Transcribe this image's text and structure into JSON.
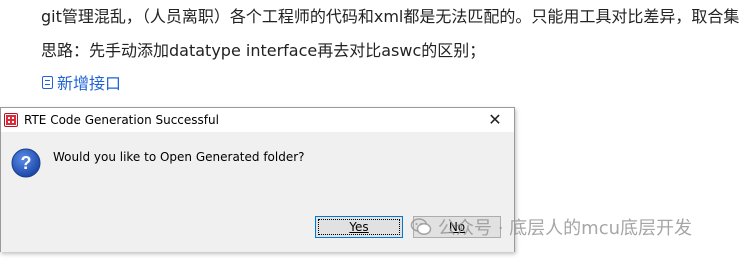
{
  "article": {
    "line1": "git管理混乱，（人员离职）各个工程师的代码和xml都是无法匹配的。只能用工具对比差异，取合集",
    "line2": "思路：先手动添加datatype interface再去对比aswc的区别；",
    "link_label": "新增接口"
  },
  "dialog": {
    "title": "RTE Code Generation Successful",
    "message": "Would you like to Open Generated folder?",
    "close_symbol": "✕",
    "yes_label": "Yes",
    "no_label": "No"
  },
  "watermark": {
    "text": "公众号 · 底层人的mcu底层开发"
  },
  "icons": {
    "app_icon": "rte-app-icon",
    "question_icon": "question-icon",
    "document_icon": "document-icon",
    "wechat_icon": "wechat-icon"
  }
}
